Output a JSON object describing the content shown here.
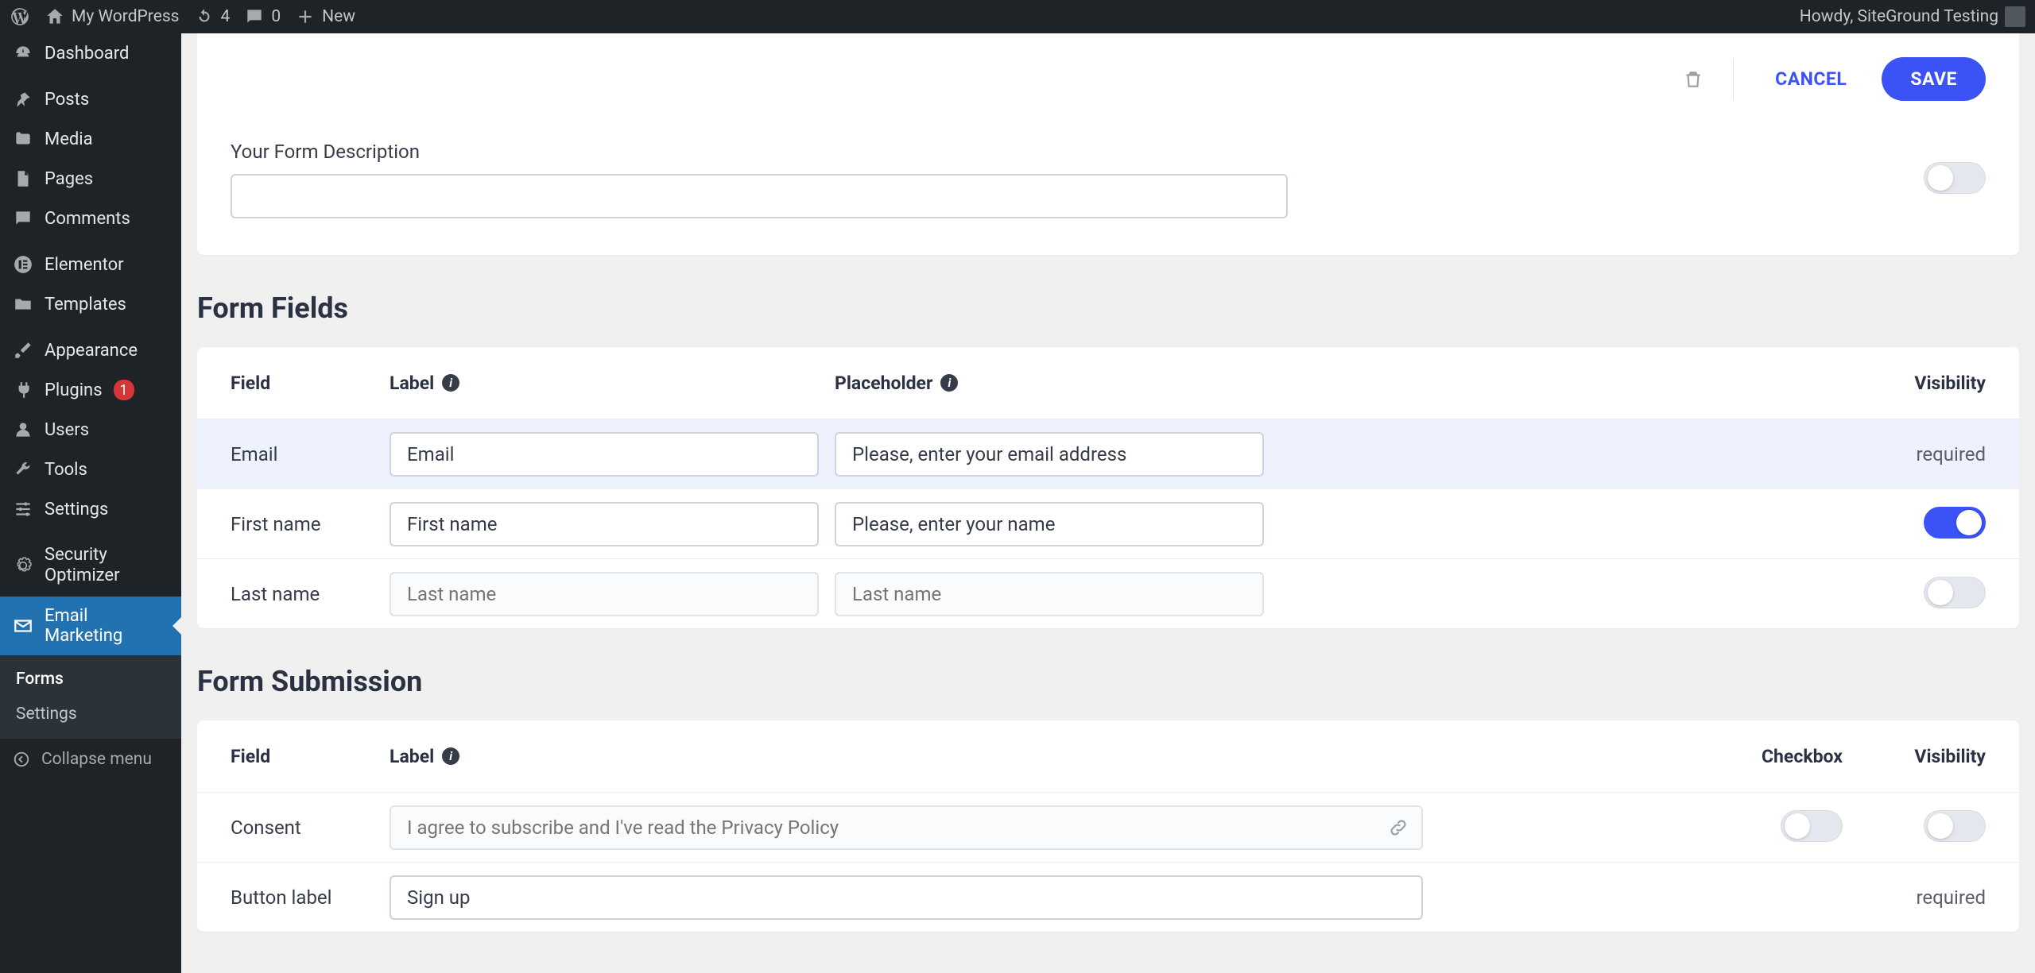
{
  "adminbar": {
    "site_name": "My WordPress",
    "refresh_count": "4",
    "comments_count": "0",
    "new_label": "New",
    "howdy": "Howdy, SiteGround Testing"
  },
  "sidebar": {
    "items": [
      {
        "label": "Dashboard"
      },
      {
        "label": "Posts"
      },
      {
        "label": "Media"
      },
      {
        "label": "Pages"
      },
      {
        "label": "Comments"
      },
      {
        "label": "Elementor"
      },
      {
        "label": "Templates"
      },
      {
        "label": "Appearance"
      },
      {
        "label": "Plugins",
        "badge": "1"
      },
      {
        "label": "Users"
      },
      {
        "label": "Tools"
      },
      {
        "label": "Settings"
      },
      {
        "label": "Security Optimizer"
      },
      {
        "label": "Email Marketing"
      }
    ],
    "submenu": {
      "forms": "Forms",
      "settings": "Settings"
    },
    "collapse": "Collapse menu"
  },
  "actions": {
    "cancel": "CANCEL",
    "save": "SAVE"
  },
  "form_description": {
    "label": "Your Form Description",
    "value": ""
  },
  "sections": {
    "fields_title": "Form Fields",
    "submission_title": "Form Submission"
  },
  "headers": {
    "field": "Field",
    "label": "Label",
    "placeholder": "Placeholder",
    "visibility": "Visibility",
    "checkbox": "Checkbox"
  },
  "fields": [
    {
      "name": "Email",
      "label": "Email",
      "placeholder": "Please, enter your email address",
      "visibility": "required",
      "toggle": null
    },
    {
      "name": "First name",
      "label": "First name",
      "placeholder": "Please, enter your name",
      "visibility": null,
      "toggle": true
    },
    {
      "name": "Last name",
      "label": "",
      "label_placeholder": "Last name",
      "placeholder": "",
      "placeholder_placeholder": "Last name",
      "visibility": null,
      "toggle": false
    }
  ],
  "submission": {
    "consent": {
      "field": "Consent",
      "label_value": "",
      "label_placeholder": "I agree to subscribe and I've read the Privacy Policy",
      "checkbox_toggle": false,
      "visibility_toggle": false
    },
    "button": {
      "field": "Button label",
      "label_value": "Sign up",
      "visibility": "required"
    }
  }
}
